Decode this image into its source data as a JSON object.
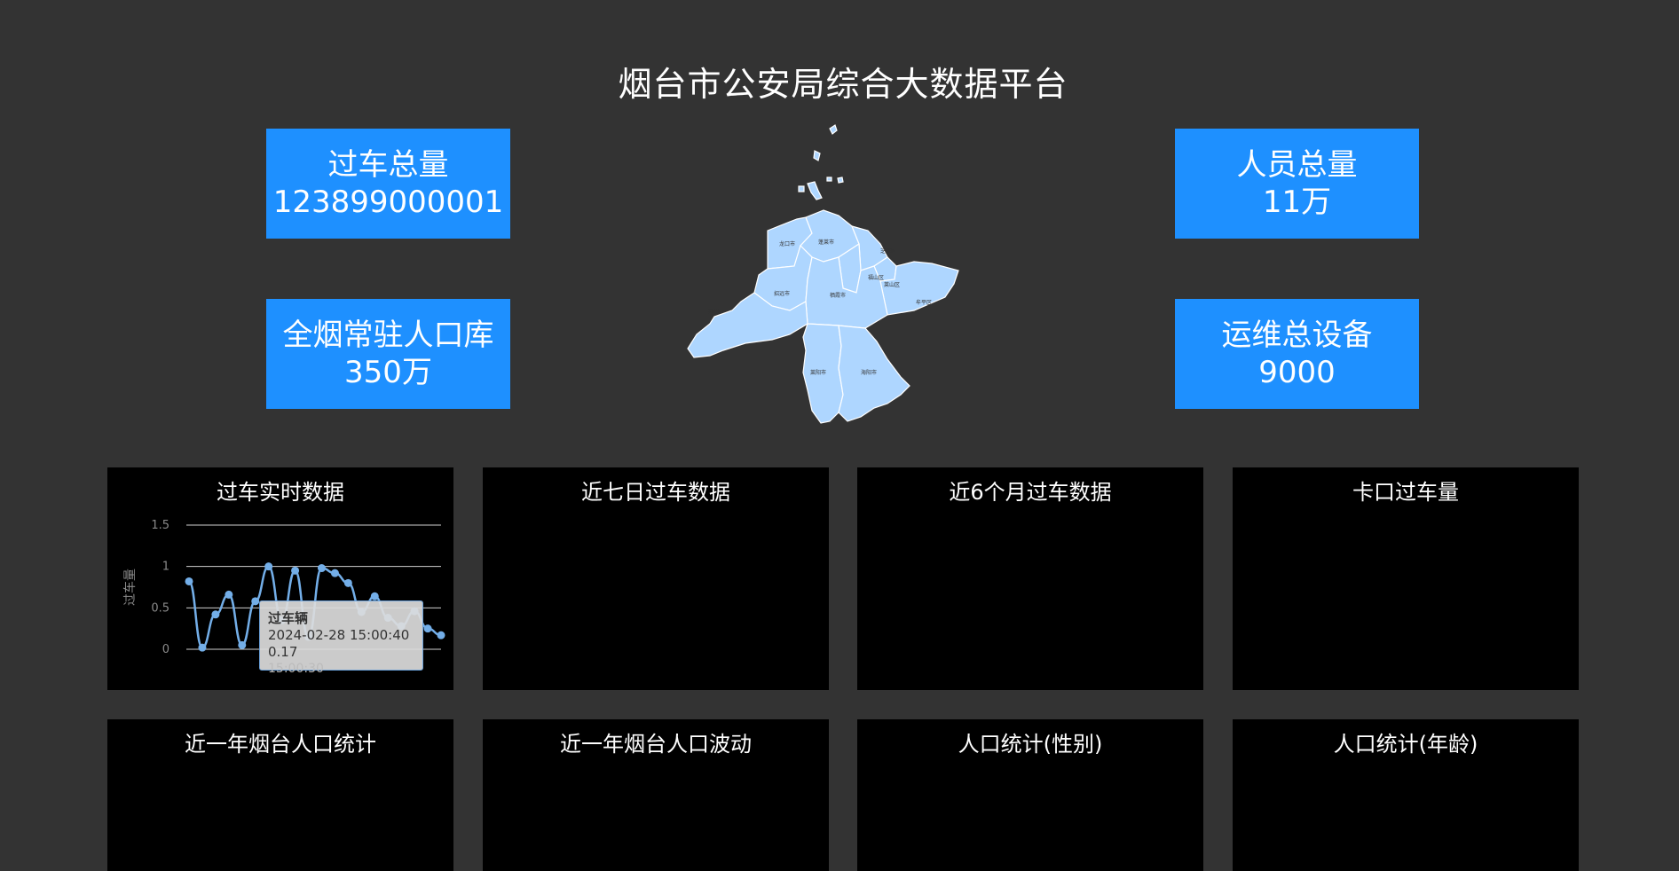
{
  "page_title": "烟台市公安局综合大数据平台",
  "stats": {
    "vehicles": {
      "label": "过车总量",
      "value": "123899000001"
    },
    "population": {
      "label": "全烟常驻人口库",
      "value": "350万"
    },
    "persons": {
      "label": "人员总量",
      "value": "11万"
    },
    "devices": {
      "label": "运维总设备",
      "value": "9000"
    }
  },
  "panels": {
    "realtime": {
      "title": "过车实时数据"
    },
    "seven_days": {
      "title": "近七日过车数据"
    },
    "six_months": {
      "title": "近6个月过车数据"
    },
    "checkpoint": {
      "title": "卡口过车量"
    },
    "pop_year": {
      "title": "近一年烟台人口统计"
    },
    "pop_wave": {
      "title": "近一年烟台人口波动"
    },
    "pop_gender": {
      "title": "人口统计(性别)"
    },
    "pop_age": {
      "title": "人口统计(年龄)"
    }
  },
  "colors": {
    "accent": "#1e90ff",
    "map_fill": "#aed6ff",
    "line": "#73aee8"
  },
  "chart_data": {
    "type": "line",
    "title": "",
    "ylabel": "过车量",
    "ylim": [
      0,
      1.5
    ],
    "yticks": [
      "0",
      "0.5",
      "1",
      "1.5"
    ],
    "series": [
      {
        "name": "过车辆",
        "values": [
          0.82,
          0.02,
          0.42,
          0.66,
          0.05,
          0.58,
          1.0,
          0.35,
          0.95,
          0.15,
          0.98,
          0.92,
          0.8,
          0.45,
          0.64,
          0.38,
          0.28,
          0.46,
          0.25,
          0.17
        ]
      }
    ],
    "tooltip": {
      "series": "过车辆",
      "time": "2024-02-28 15:00:40",
      "value": "0.17",
      "ghost_label": "15:00:30"
    }
  },
  "map": {
    "labels": [
      "龙口市",
      "蓬莱市",
      "招远市",
      "栖霞市",
      "福山区",
      "芝罘区",
      "莱山区",
      "牟平区",
      "莱州市",
      "莱阳市",
      "海阳市"
    ]
  }
}
